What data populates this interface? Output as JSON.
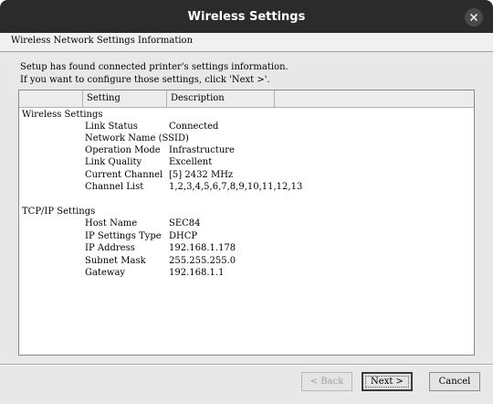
{
  "window": {
    "title": "Wireless Settings"
  },
  "header": {
    "title": "Wireless Network Settings Information"
  },
  "intro": {
    "line1": "Setup has found connected printer's settings information.",
    "line2": "If you want to configure those settings, click 'Next >'."
  },
  "table": {
    "columns": [
      "",
      "Setting",
      "Description",
      ""
    ],
    "groups": [
      {
        "name": "Wireless Settings",
        "rows": [
          {
            "setting": "Link Status",
            "value": "Connected"
          },
          {
            "setting": "Network Name (SSID)",
            "value": ""
          },
          {
            "setting": "Operation Mode",
            "value": "Infrastructure"
          },
          {
            "setting": "Link Quality",
            "value": "Excellent"
          },
          {
            "setting": "Current Channel",
            "value": "[5] 2432 MHz"
          },
          {
            "setting": "Channel List",
            "value": "1,2,3,4,5,6,7,8,9,10,11,12,13"
          }
        ]
      },
      {
        "name": "TCP/IP Settings",
        "rows": [
          {
            "setting": "Host Name",
            "value": "SEC84"
          },
          {
            "setting": "IP Settings Type",
            "value": "DHCP"
          },
          {
            "setting": "IP Address",
            "value": "192.168.1.178"
          },
          {
            "setting": "Subnet Mask",
            "value": "255.255.255.0"
          },
          {
            "setting": "Gateway",
            "value": "192.168.1.1"
          }
        ]
      }
    ]
  },
  "buttons": {
    "back": "< Back",
    "next": "Next >",
    "cancel": "Cancel"
  }
}
